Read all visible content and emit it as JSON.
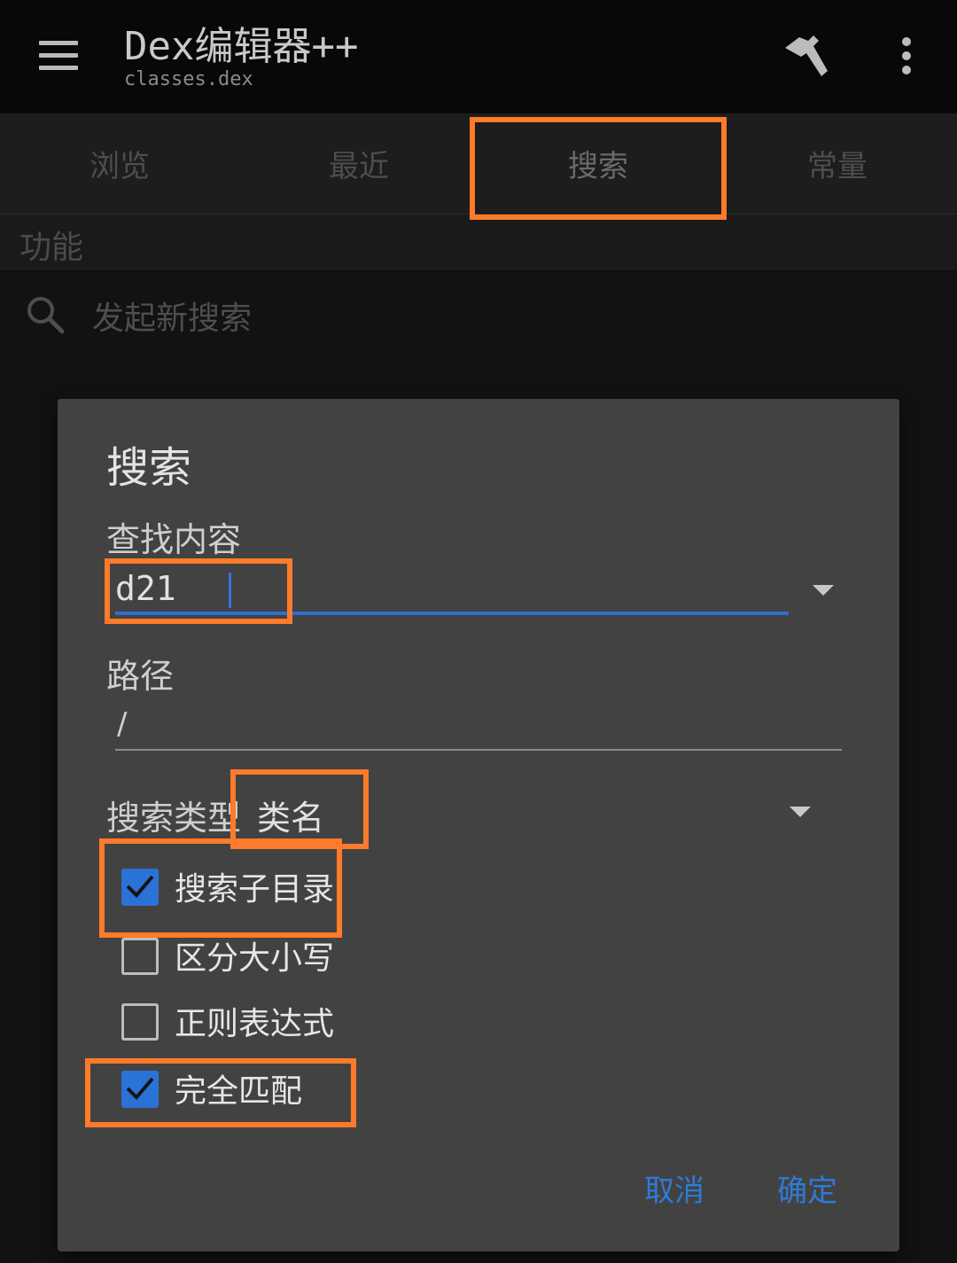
{
  "app": {
    "title": "Dex编辑器++",
    "subtitle": "classes.dex",
    "icons": {
      "menu": "hamburger-menu-icon",
      "build": "hammer-icon",
      "more": "more-vert-icon"
    }
  },
  "tabs": [
    {
      "label": "浏览",
      "active": false
    },
    {
      "label": "最近",
      "active": false
    },
    {
      "label": "搜索",
      "active": true
    },
    {
      "label": "常量",
      "active": false
    }
  ],
  "section": {
    "label": "功能"
  },
  "list": {
    "new_search_label": "发起新搜索",
    "icon": "search-icon"
  },
  "dialog": {
    "title": "搜索",
    "find_label": "查找内容",
    "find_value": "d21",
    "path_label": "路径",
    "path_value": "/",
    "type_label": "搜索类型",
    "type_value": "类名",
    "options": [
      {
        "label": "搜索子目录",
        "checked": true
      },
      {
        "label": "区分大小写",
        "checked": false
      },
      {
        "label": "正则表达式",
        "checked": false
      },
      {
        "label": "完全匹配",
        "checked": true
      }
    ],
    "cancel_label": "取消",
    "ok_label": "确定"
  },
  "colors": {
    "accent": "#2f74e0",
    "highlight": "#ff7a2a",
    "dialog_bg": "#424242"
  }
}
